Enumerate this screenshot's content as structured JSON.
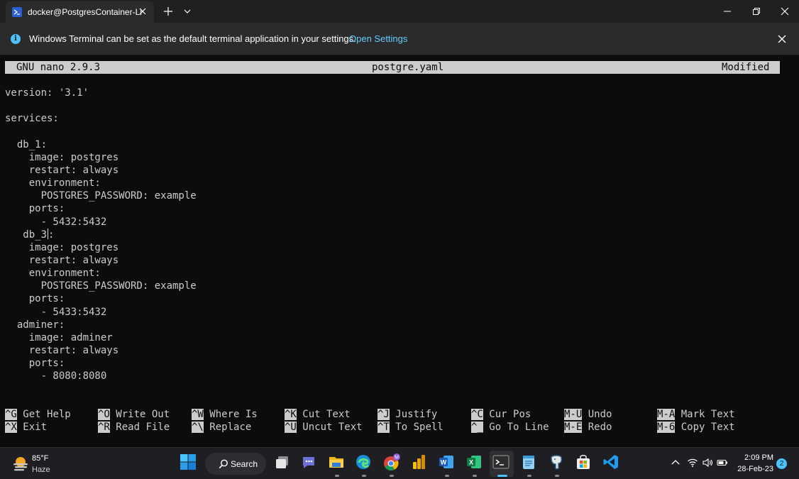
{
  "tab": {
    "title": "docker@PostgresContainer-Li"
  },
  "infobar": {
    "message": "Windows Terminal can be set as the default terminal application in your settings.",
    "link": "Open Settings"
  },
  "nano": {
    "version": "GNU nano 2.9.3",
    "filename": "postgre.yaml",
    "status": "Modified",
    "lines": [
      "version: '3.1'",
      "",
      "services:",
      "",
      "  db_1:",
      "    image: postgres",
      "    restart: always",
      "    environment:",
      "      POSTGRES_PASSWORD: example",
      "    ports:",
      "      - 5432:5432",
      "   db_3",
      "    image: postgres",
      "    restart: always",
      "    environment:",
      "      POSTGRES_PASSWORD: example",
      "    ports:",
      "      - 5433:5432",
      "  adminer:",
      "    image: adminer",
      "    restart: always",
      "    ports:",
      "      - 8080:8080"
    ],
    "cursor_line_suffix": ":",
    "shortcuts_row1": [
      {
        "key": "^G",
        "label": "Get Help"
      },
      {
        "key": "^O",
        "label": "Write Out"
      },
      {
        "key": "^W",
        "label": "Where Is"
      },
      {
        "key": "^K",
        "label": "Cut Text"
      },
      {
        "key": "^J",
        "label": "Justify"
      },
      {
        "key": "^C",
        "label": "Cur Pos"
      },
      {
        "key": "M-U",
        "label": "Undo"
      },
      {
        "key": "M-A",
        "label": "Mark Text"
      }
    ],
    "shortcuts_row2": [
      {
        "key": "^X",
        "label": "Exit"
      },
      {
        "key": "^R",
        "label": "Read File"
      },
      {
        "key": "^\\",
        "label": "Replace"
      },
      {
        "key": "^U",
        "label": "Uncut Text"
      },
      {
        "key": "^T",
        "label": "To Spell"
      },
      {
        "key": "^_",
        "label": "Go To Line"
      },
      {
        "key": "M-E",
        "label": "Redo"
      },
      {
        "key": "M-6",
        "label": "Copy Text"
      }
    ]
  },
  "taskbar": {
    "weather_temp": "85°F",
    "weather_desc": "Haze",
    "search_label": "Search",
    "time": "2:09 PM",
    "date": "28-Feb-23",
    "notification_count": "2",
    "apps": [
      "windows-start-icon",
      "task-view-icon",
      "teams-chat-icon",
      "file-explorer-icon",
      "edge-icon",
      "chrome-icon",
      "power-bi-icon",
      "word-icon",
      "excel-icon",
      "terminal-icon",
      "notepad-icon",
      "pgadmin-icon",
      "microsoft-store-icon",
      "vscode-icon"
    ]
  },
  "colors": {
    "accent": "#4cc2ff",
    "link": "#60cdff",
    "terminal_bg": "#0c0c0c",
    "terminal_fg": "#cccccc"
  }
}
